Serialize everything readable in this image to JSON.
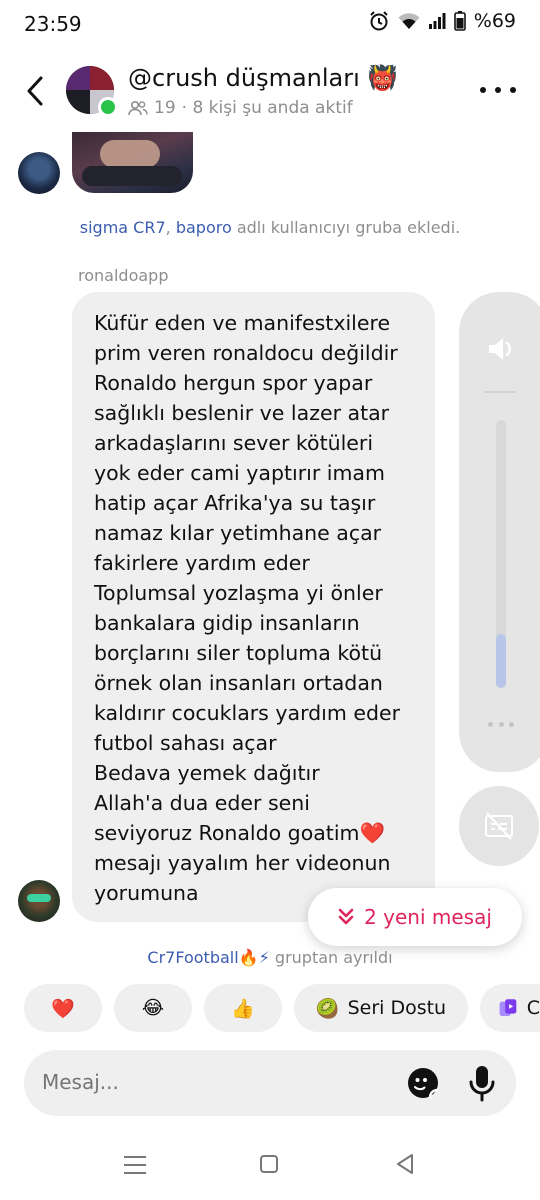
{
  "status_bar": {
    "time": "23:59",
    "battery": "%69"
  },
  "header": {
    "title": "@crush düşmanları",
    "title_emoji": "👹",
    "member_count": "19",
    "active_text": "· 8 kişi şu anda aktif"
  },
  "system_notice": {
    "user1": "sigma CR7",
    "separator": ", ",
    "user2": "baporo",
    "text": " adlı kullanıcıyı gruba ekledi."
  },
  "message": {
    "sender": "ronaldoapp",
    "text": "Küfür eden ve manifestxilere\nprim veren  ronaldocu değildir\nRonaldo hergun spor yapar\nsağlıklı beslenir ve lazer atar\narkadaşlarını sever kötüleri\nyok eder cami yaptırır imam\nhatip açar Afrika'ya su taşır\nnamaz kılar yetimhane açar\nfakirlere yardım eder\nToplumsal yozlaşma yi önler\nbankalara gidip insanların\nborçlarını siler topluma kötü\nörnek olan insanları ortadan\nkaldırır cocuklars yardım eder\nfutbol sahası açar\nBedava yemek dağıtır\nAllah'a dua eder seni\nseviyoruz Ronaldo goatim❤️\nmesajı yayalım her videonun\nyorumuna"
  },
  "volume_overlay": {
    "level": 0.2
  },
  "new_messages": {
    "label": "2 yeni mesaj"
  },
  "left_notice": {
    "user": "Cr7Football🔥⚡",
    "text": " gruptan ayrıldı"
  },
  "quick_reactions": [
    {
      "emoji": "❤️",
      "label": ""
    },
    {
      "emoji": "😂",
      "label": ""
    },
    {
      "emoji": "👍",
      "label": ""
    },
    {
      "emoji": "🥝",
      "label": "Seri Dostu"
    },
    {
      "emoji": "",
      "label": "C"
    }
  ],
  "composer": {
    "placeholder": "Mesaj..."
  },
  "colors": {
    "accent_pink": "#e0245e",
    "link_blue": "#3b5db0",
    "online_green": "#2bc24a"
  }
}
